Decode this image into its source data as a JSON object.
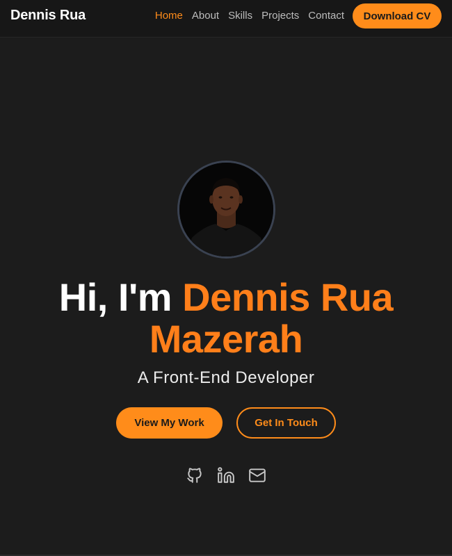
{
  "header": {
    "brand": "Dennis Rua",
    "nav": [
      {
        "label": "Home",
        "active": true
      },
      {
        "label": "About",
        "active": false
      },
      {
        "label": "Skills",
        "active": false
      },
      {
        "label": "Projects",
        "active": false
      },
      {
        "label": "Contact",
        "active": false
      }
    ],
    "cv_button": "Download CV"
  },
  "hero": {
    "greeting": "Hi, I'm ",
    "name": "Dennis Rua Mazerah",
    "subtitle": "A Front-End Developer",
    "primary_button": "View My Work",
    "secondary_button": "Get In Touch"
  },
  "social": [
    {
      "icon": "github-icon"
    },
    {
      "icon": "linkedin-icon"
    },
    {
      "icon": "mail-icon"
    }
  ],
  "colors": {
    "accent": "#ff8c1a",
    "background": "#1c1c1c",
    "navbar": "#171717"
  }
}
